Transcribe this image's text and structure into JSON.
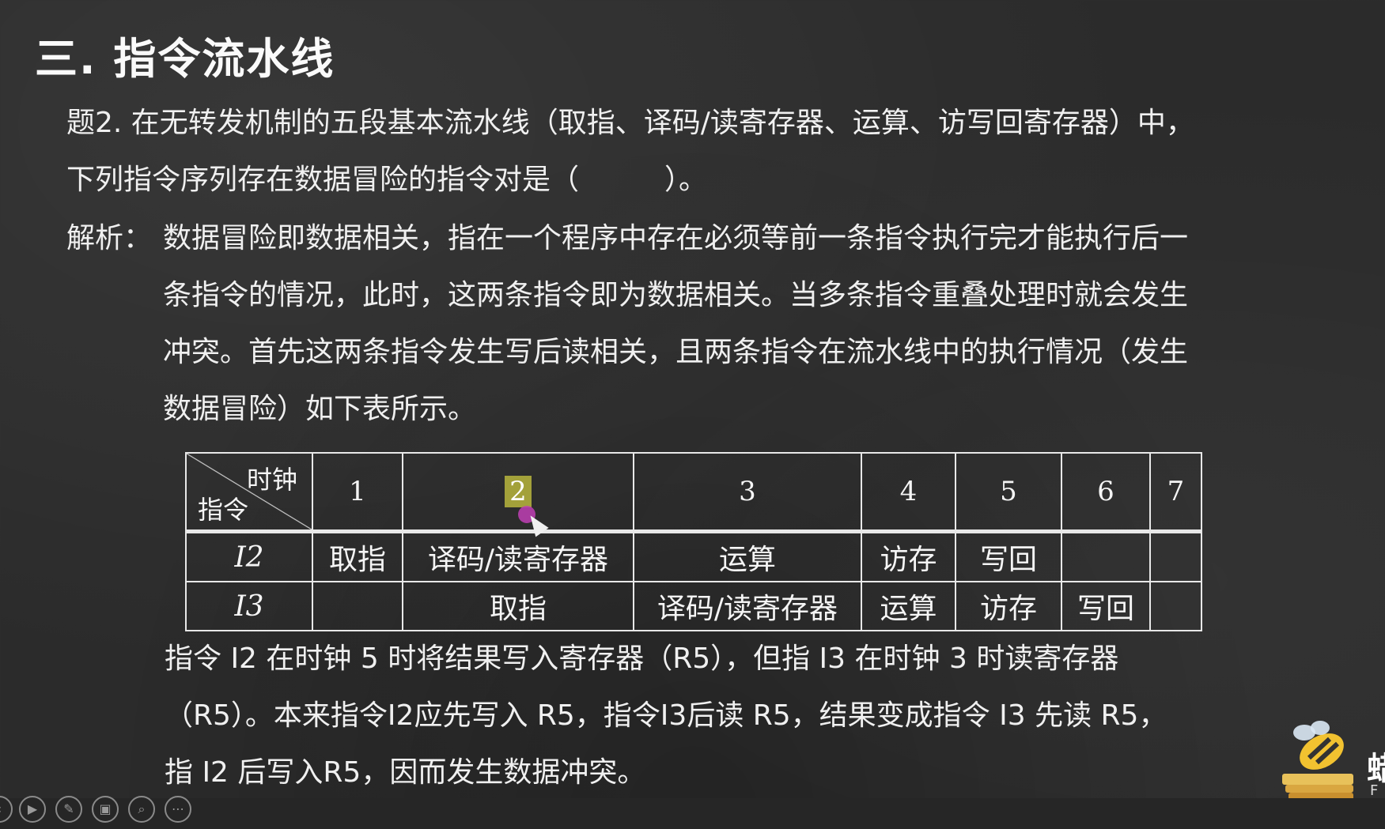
{
  "title": "三. 指令流水线",
  "question": {
    "line1": "题2. 在无转发机制的五段基本流水线（取指、译码/读寄存器、运算、访写回寄存器）中，",
    "line2": "下列指令序列存在数据冒险的指令对是（　　　）。"
  },
  "analysis": {
    "label": "解析：",
    "lines": [
      "数据冒险即数据相关，指在一个程序中存在必须等前一条指令执行完才能执行后一",
      "条指令的情况，此时，这两条指令即为数据相关。当多条指令重叠处理时就会发生",
      "冲突。首先这两条指令发生写后读相关，且两条指令在流水线中的执行情况（发生",
      "数据冒险）如下表所示。"
    ]
  },
  "table": {
    "corner_top": "时钟",
    "corner_bottom": "指令",
    "clocks": [
      "1",
      "2",
      "3",
      "4",
      "5",
      "6",
      "7"
    ],
    "highlighted_clock": "2",
    "rows": [
      {
        "instr": "I2",
        "cells": [
          "取指",
          "译码/读寄存器",
          "运算",
          "访存",
          "写回",
          "",
          ""
        ]
      },
      {
        "instr": "I3",
        "cells": [
          "",
          "取指",
          "译码/读寄存器",
          "运算",
          "访存",
          "写回",
          ""
        ]
      }
    ]
  },
  "explanation": {
    "line1": "指令 I2 在时钟 5 时将结果写入寄存器（R5），但指 I3 在时钟 3 时读寄存器",
    "line2": "（R5）。本来指令I2应先写入 R5，指令I3后读 R5，结果变成指令 I3 先读 R5，",
    "line3": "指 I2 后写入R5，因而发生数据冲突。"
  },
  "logo": {
    "text": "蜡",
    "sub": "F"
  },
  "toolbar": {
    "icons": [
      "back-icon",
      "play-icon",
      "pen-icon",
      "slides-icon",
      "zoom-icon",
      "more-icon"
    ]
  }
}
